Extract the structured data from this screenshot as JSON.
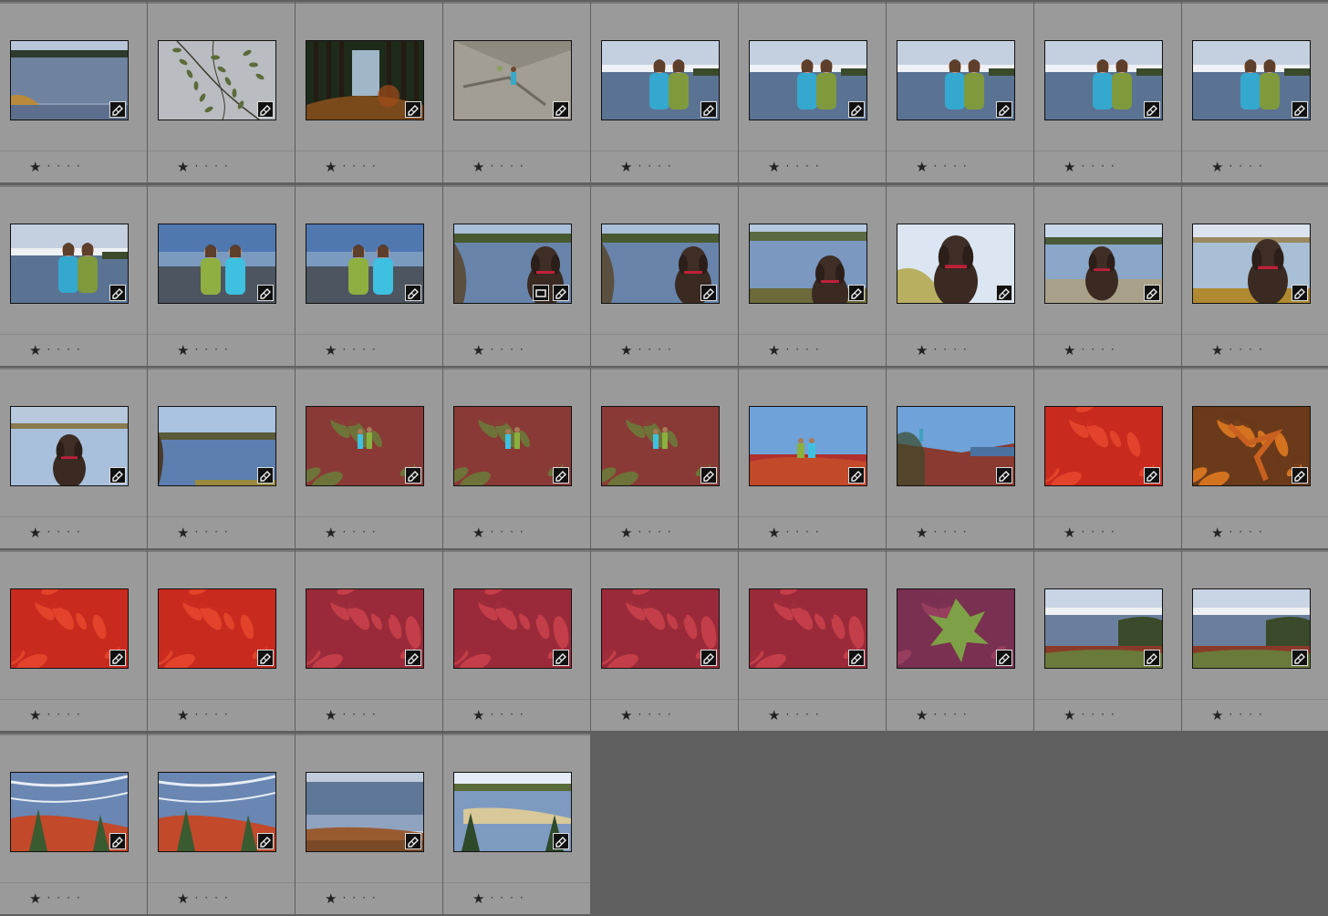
{
  "grid": {
    "columns": 9,
    "thumbnails": [
      {
        "scene": "lake-reflection",
        "rating": "★",
        "dots": "····",
        "badges": [
          "edit-badge-icon"
        ]
      },
      {
        "scene": "branch-over-water",
        "rating": "★",
        "dots": "····",
        "badges": [
          "edit-badge-icon"
        ]
      },
      {
        "scene": "forest-path",
        "rating": "★",
        "dots": "····",
        "badges": [
          "edit-badge-icon"
        ]
      },
      {
        "scene": "rock-climber",
        "rating": "★",
        "dots": "····",
        "badges": [
          "edit-badge-icon"
        ]
      },
      {
        "scene": "two-girls-sea",
        "rating": "★",
        "dots": "····",
        "badges": [
          "edit-badge-icon"
        ]
      },
      {
        "scene": "two-girls-sea",
        "rating": "★",
        "dots": "····",
        "badges": [
          "edit-badge-icon"
        ]
      },
      {
        "scene": "two-girls-sea",
        "rating": "★",
        "dots": "····",
        "badges": [
          "edit-badge-icon"
        ]
      },
      {
        "scene": "two-girls-sea",
        "rating": "★",
        "dots": "····",
        "badges": [
          "edit-badge-icon"
        ]
      },
      {
        "scene": "two-girls-sea",
        "rating": "★",
        "dots": "····",
        "badges": [
          "edit-badge-icon"
        ]
      },
      {
        "scene": "two-girls-sea",
        "rating": "★",
        "dots": "····",
        "badges": [
          "edit-badge-icon"
        ]
      },
      {
        "scene": "two-girls-beach",
        "rating": "★",
        "dots": "····",
        "badges": [
          "edit-badge-icon"
        ]
      },
      {
        "scene": "two-girls-beach",
        "rating": "★",
        "dots": "····",
        "badges": [
          "edit-badge-icon"
        ]
      },
      {
        "scene": "dog-cove",
        "rating": "★",
        "dots": "····",
        "badges": [
          "edit-badge-icon",
          "crop-badge-icon"
        ]
      },
      {
        "scene": "dog-cove",
        "rating": "★",
        "dots": "····",
        "badges": [
          "edit-badge-icon"
        ]
      },
      {
        "scene": "dog-beach",
        "rating": "★",
        "dots": "····",
        "badges": [
          "edit-badge-icon"
        ]
      },
      {
        "scene": "dog-closeup",
        "rating": "★",
        "dots": "····",
        "badges": [
          "edit-badge-icon"
        ]
      },
      {
        "scene": "dog-standing",
        "rating": "★",
        "dots": "····",
        "badges": [
          "edit-badge-icon"
        ]
      },
      {
        "scene": "dog-profile",
        "rating": "★",
        "dots": "····",
        "badges": [
          "edit-badge-icon"
        ]
      },
      {
        "scene": "dog-back",
        "rating": "★",
        "dots": "····",
        "badges": [
          "edit-badge-icon"
        ]
      },
      {
        "scene": "cove-view",
        "rating": "★",
        "dots": "····",
        "badges": [
          "edit-badge-icon"
        ]
      },
      {
        "scene": "girls-field",
        "rating": "★",
        "dots": "····",
        "badges": [
          "edit-badge-icon"
        ]
      },
      {
        "scene": "girls-field",
        "rating": "★",
        "dots": "····",
        "badges": [
          "edit-badge-icon"
        ]
      },
      {
        "scene": "girls-field",
        "rating": "★",
        "dots": "····",
        "badges": [
          "edit-badge-icon"
        ]
      },
      {
        "scene": "girls-sky-field",
        "rating": "★",
        "dots": "····",
        "badges": [
          "edit-badge-icon"
        ]
      },
      {
        "scene": "hill-field",
        "rating": "★",
        "dots": "····",
        "badges": [
          "edit-badge-icon"
        ]
      },
      {
        "scene": "red-leaves",
        "rating": "★",
        "dots": "····",
        "badges": [
          "edit-badge-icon"
        ]
      },
      {
        "scene": "orange-leaves",
        "rating": "★",
        "dots": "····",
        "badges": [
          "edit-badge-icon"
        ]
      },
      {
        "scene": "red-leaves",
        "rating": "★",
        "dots": "····",
        "badges": [
          "edit-badge-icon"
        ]
      },
      {
        "scene": "red-leaves",
        "rating": "★",
        "dots": "····",
        "badges": [
          "edit-badge-icon"
        ]
      },
      {
        "scene": "crimson-leaves",
        "rating": "★",
        "dots": "····",
        "badges": [
          "edit-badge-icon"
        ]
      },
      {
        "scene": "crimson-leaves",
        "rating": "★",
        "dots": "····",
        "badges": [
          "edit-badge-icon"
        ]
      },
      {
        "scene": "crimson-leaves",
        "rating": "★",
        "dots": "····",
        "badges": [
          "edit-badge-icon"
        ]
      },
      {
        "scene": "crimson-leaves",
        "rating": "★",
        "dots": "····",
        "badges": [
          "edit-badge-icon"
        ]
      },
      {
        "scene": "green-plant",
        "rating": "★",
        "dots": "····",
        "badges": [
          "edit-badge-icon"
        ]
      },
      {
        "scene": "sea-coast",
        "rating": "★",
        "dots": "····",
        "badges": [
          "edit-badge-icon"
        ]
      },
      {
        "scene": "sea-coast",
        "rating": "★",
        "dots": "····",
        "badges": [
          "edit-badge-icon"
        ]
      },
      {
        "scene": "surf-bushes",
        "rating": "★",
        "dots": "····",
        "badges": [
          "edit-badge-icon"
        ]
      },
      {
        "scene": "surf-bushes",
        "rating": "★",
        "dots": "····",
        "badges": [
          "edit-badge-icon"
        ]
      },
      {
        "scene": "tidal-flat",
        "rating": "★",
        "dots": "····",
        "badges": [
          "edit-badge-icon"
        ]
      },
      {
        "scene": "estuary-pines",
        "rating": "★",
        "dots": "····",
        "badges": [
          "edit-badge-icon"
        ]
      }
    ]
  },
  "colors": {
    "cell_bg": "#9a9a9a",
    "empty_bg": "#5f5f5f",
    "divider": "#7a7a7a"
  }
}
